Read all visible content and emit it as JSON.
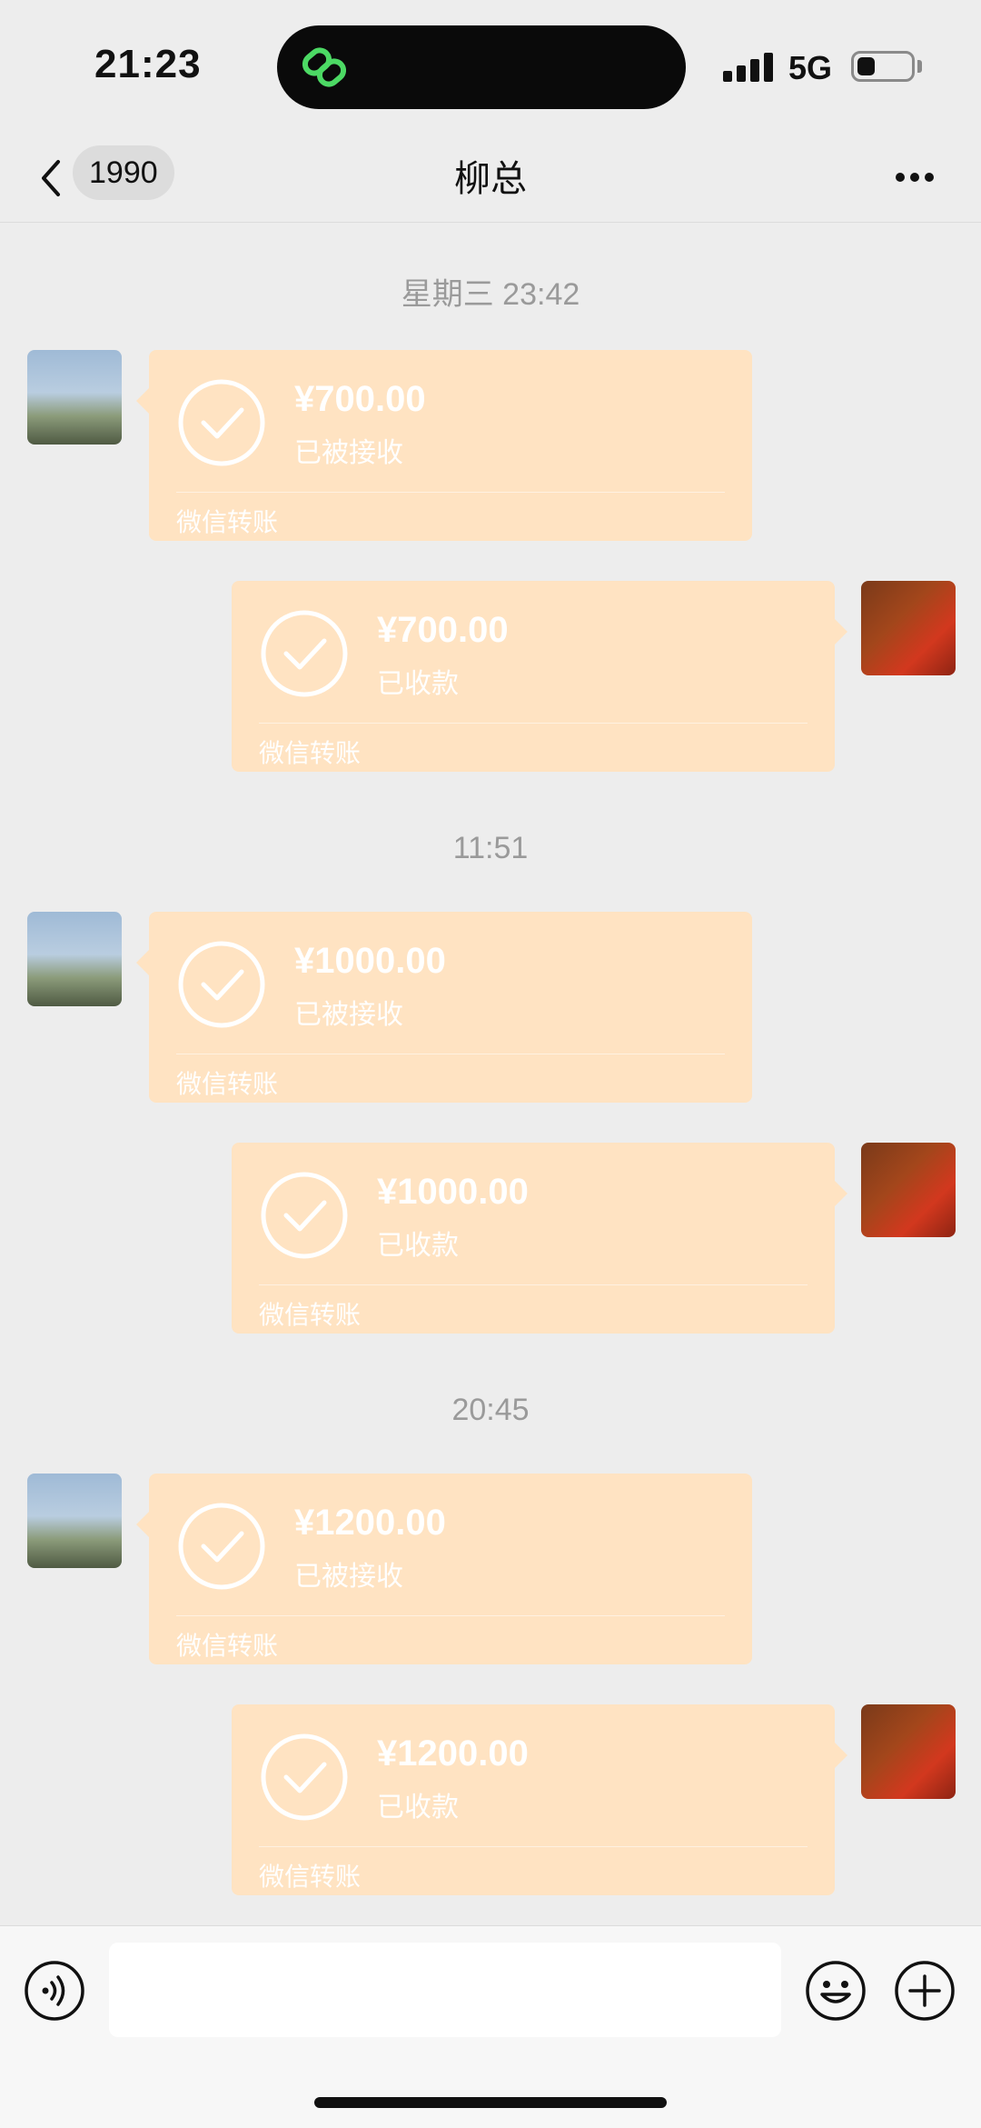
{
  "status_bar": {
    "time": "21:23",
    "network": "5G",
    "battery_level": 0.3
  },
  "nav": {
    "unread_count": "1990",
    "title": "柳总"
  },
  "messages": [
    {
      "timestamp": "星期三 23:42",
      "incoming": {
        "amount": "¥700.00",
        "status": "已被接收",
        "footer": "微信转账"
      },
      "outgoing": {
        "amount": "¥700.00",
        "status": "已收款",
        "footer": "微信转账"
      }
    },
    {
      "timestamp": "11:51",
      "incoming": {
        "amount": "¥1000.00",
        "status": "已被接收",
        "footer": "微信转账"
      },
      "outgoing": {
        "amount": "¥1000.00",
        "status": "已收款",
        "footer": "微信转账"
      }
    },
    {
      "timestamp": "20:45",
      "incoming": {
        "amount": "¥1200.00",
        "status": "已被接收",
        "footer": "微信转账"
      },
      "outgoing": {
        "amount": "¥1200.00",
        "status": "已收款",
        "footer": "微信转账"
      }
    }
  ],
  "input": {
    "value": ""
  },
  "colors": {
    "transfer_card": "#ffe3c2",
    "background": "#ededed",
    "island_icon": "#4cd964"
  }
}
